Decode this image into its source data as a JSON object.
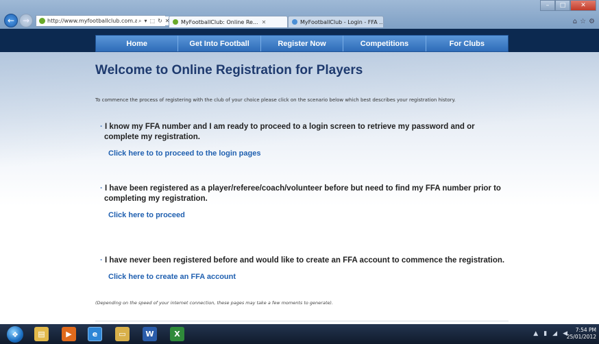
{
  "browser": {
    "address": "http://www.myfootballclub.com.au/index.php?",
    "address_tools": [
      "⌕",
      "▾",
      "⬚",
      "↻",
      "✕"
    ],
    "tabs": [
      {
        "label": "MyFootballClub: Online Re...",
        "close": "✕"
      },
      {
        "label": "MyFootballClub - Login - FFA ..."
      }
    ],
    "window_buttons": {
      "minimize": "–",
      "maximize": "□",
      "close": "✕"
    },
    "toolbar_icons": {
      "home": "⌂",
      "favorites": "☆",
      "tools": "⚙"
    }
  },
  "menu": {
    "items": [
      "Home",
      "Get Into Football",
      "Register Now",
      "Competitions",
      "For Clubs"
    ]
  },
  "page": {
    "title": "Welcome to Online Registration for Players",
    "intro": "To commence the process of registering with the club of your choice please click on the scenario below which best describes your registration history.",
    "options": [
      {
        "text": "I know my FFA number and I am ready to proceed to a login screen to retrieve my password and or complete my registration.",
        "link": "Click here to to proceed to the login pages"
      },
      {
        "text": "I have been registered as a player/referee/coach/volunteer before but need to find my FFA number prior to completing my registration.",
        "link": "Click here to proceed"
      },
      {
        "text": "I have never been registered before and would like to create an FFA account to commence the registration.",
        "link": "Click here to create an FFA account"
      }
    ],
    "footnote": "(Depending on the speed of your internet connection, these pages may take a few moments to generate)."
  },
  "taskbar": {
    "apps": [
      "explorer-icon",
      "media-player-icon",
      "internet-explorer-icon",
      "folder-icon",
      "word-icon",
      "excel-icon"
    ],
    "time": "7:54 PM",
    "date": "25/01/2012"
  }
}
